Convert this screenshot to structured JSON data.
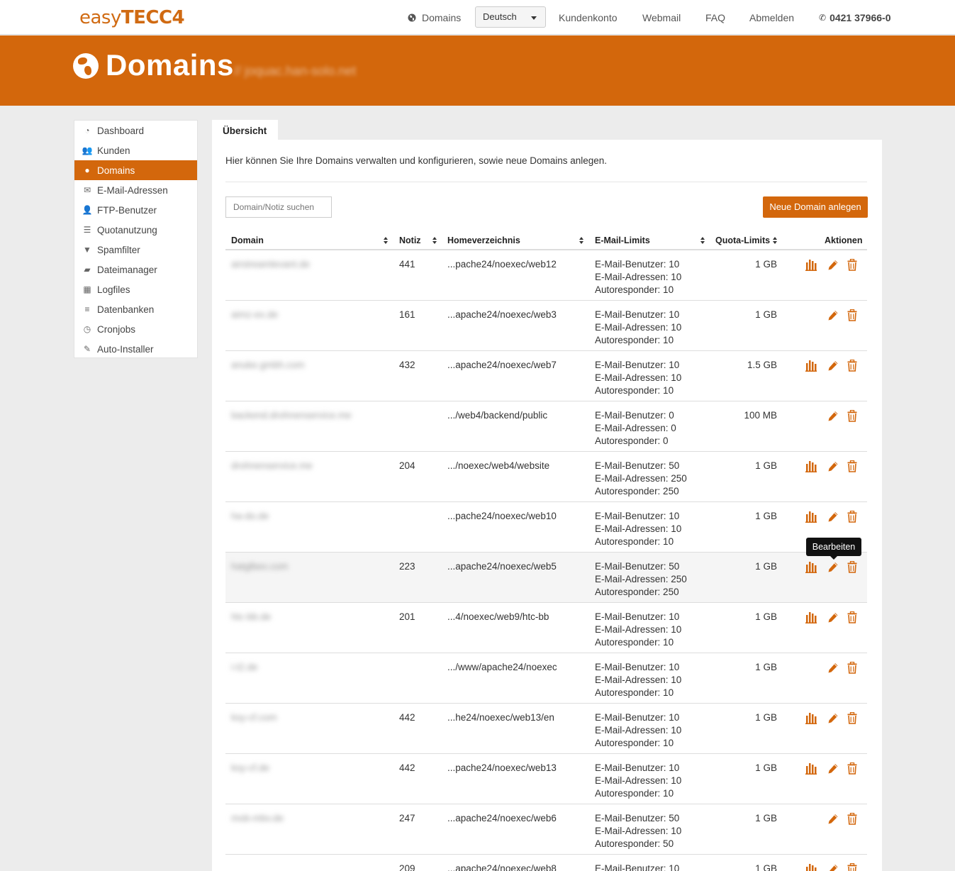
{
  "brand": {
    "part1": "easy",
    "part2": "TECC4"
  },
  "topnav": {
    "domains_label": "Domains",
    "language": "Deutsch",
    "customer_account": "Kundenkonto",
    "webmail": "Webmail",
    "faq": "FAQ",
    "logout": "Abmelden",
    "phone": "0421 37966-0"
  },
  "hero": {
    "title": "Domains",
    "subtitle": "// joquac.han-solo.net"
  },
  "sidebar": {
    "items": [
      {
        "label": "Dashboard",
        "icon": "dashboard-icon",
        "glyph": "◔"
      },
      {
        "label": "Kunden",
        "icon": "users-icon",
        "glyph": "👥"
      },
      {
        "label": "Domains",
        "icon": "globe-icon",
        "glyph": "●",
        "active": true
      },
      {
        "label": "E-Mail-Adressen",
        "icon": "envelope-icon",
        "glyph": "✉"
      },
      {
        "label": "FTP-Benutzer",
        "icon": "user-icon",
        "glyph": "👤"
      },
      {
        "label": "Quotanutzung",
        "icon": "tasks-icon",
        "glyph": "☰"
      },
      {
        "label": "Spamfilter",
        "icon": "filter-icon",
        "glyph": "▼"
      },
      {
        "label": "Dateimanager",
        "icon": "folder-open-icon",
        "glyph": "▰"
      },
      {
        "label": "Logfiles",
        "icon": "calendar-icon",
        "glyph": "▦"
      },
      {
        "label": "Datenbanken",
        "icon": "list-icon",
        "glyph": "≡"
      },
      {
        "label": "Cronjobs",
        "icon": "clock-icon",
        "glyph": "◷"
      },
      {
        "label": "Auto-Installer",
        "icon": "magic-icon",
        "glyph": "✎"
      }
    ]
  },
  "tab": "Übersicht",
  "intro": "Hier können Sie Ihre Domains verwalten und konfigurieren, sowie neue Domains anlegen.",
  "search_placeholder": "Domain/Notiz suchen",
  "new_domain_button": "Neue Domain anlegen",
  "columns": {
    "domain": "Domain",
    "notiz": "Notiz",
    "home": "Homeverzeichnis",
    "mail": "E-Mail-Limits",
    "quota": "Quota-Limits",
    "actions": "Aktionen"
  },
  "rows": [
    {
      "domain": "airstreamlevant.de",
      "notiz": "441",
      "home": "...pache24/noexec/web12",
      "mail": [
        "E-Mail-Benutzer: 10",
        "E-Mail-Adressen: 10",
        "Autoresponder: 10"
      ],
      "quota": "1 GB",
      "stats": true
    },
    {
      "domain": "aimz-ex.de",
      "notiz": "161",
      "home": "...apache24/noexec/web3",
      "mail": [
        "E-Mail-Benutzer: 10",
        "E-Mail-Adressen: 10",
        "Autoresponder: 10"
      ],
      "quota": "1 GB",
      "stats": false
    },
    {
      "domain": "anuke.gmbh.com",
      "notiz": "432",
      "home": "...apache24/noexec/web7",
      "mail": [
        "E-Mail-Benutzer: 10",
        "E-Mail-Adressen: 10",
        "Autoresponder: 10"
      ],
      "quota": "1.5 GB",
      "stats": true
    },
    {
      "domain": "backend.drohnenservice.me",
      "notiz": "",
      "home": ".../web4/backend/public",
      "mail": [
        "E-Mail-Benutzer: 0",
        "E-Mail-Adressen: 0",
        "Autoresponder: 0"
      ],
      "quota": "100 MB",
      "stats": false
    },
    {
      "domain": "drohnenservice.me",
      "notiz": "204",
      "home": ".../noexec/web4/website",
      "mail": [
        "E-Mail-Benutzer: 50",
        "E-Mail-Adressen: 250",
        "Autoresponder: 250"
      ],
      "quota": "1 GB",
      "stats": true
    },
    {
      "domain": "ha-do.de",
      "notiz": "",
      "home": "...pache24/noexec/web10",
      "mail": [
        "E-Mail-Benutzer: 10",
        "E-Mail-Adressen: 10",
        "Autoresponder: 10"
      ],
      "quota": "1 GB",
      "stats": true
    },
    {
      "domain": "hatglbex.com",
      "notiz": "223",
      "home": "...apache24/noexec/web5",
      "mail": [
        "E-Mail-Benutzer: 50",
        "E-Mail-Adressen: 250",
        "Autoresponder: 250"
      ],
      "quota": "1 GB",
      "stats": true,
      "hover": true
    },
    {
      "domain": "htc-bb.de",
      "notiz": "201",
      "home": "...4/noexec/web9/htc-bb",
      "mail": [
        "E-Mail-Benutzer: 10",
        "E-Mail-Adressen: 10",
        "Autoresponder: 10"
      ],
      "quota": "1 GB",
      "stats": true
    },
    {
      "domain": "i-t2.de",
      "notiz": "",
      "home": ".../www/apache24/noexec",
      "mail": [
        "E-Mail-Benutzer: 10",
        "E-Mail-Adressen: 10",
        "Autoresponder: 10"
      ],
      "quota": "1 GB",
      "stats": false
    },
    {
      "domain": "ksy-cf.com",
      "notiz": "442",
      "home": "...he24/noexec/web13/en",
      "mail": [
        "E-Mail-Benutzer: 10",
        "E-Mail-Adressen: 10",
        "Autoresponder: 10"
      ],
      "quota": "1 GB",
      "stats": true
    },
    {
      "domain": "ksy-cf.de",
      "notiz": "442",
      "home": "...pache24/noexec/web13",
      "mail": [
        "E-Mail-Benutzer: 10",
        "E-Mail-Adressen: 10",
        "Autoresponder: 10"
      ],
      "quota": "1 GB",
      "stats": true
    },
    {
      "domain": "mob-mbv.de",
      "notiz": "247",
      "home": "...apache24/noexec/web6",
      "mail": [
        "E-Mail-Benutzer: 50",
        "E-Mail-Adressen: 10",
        "Autoresponder: 50"
      ],
      "quota": "1 GB",
      "stats": false
    },
    {
      "domain": "",
      "notiz": "209",
      "home": "...apache24/noexec/web8",
      "mail": [
        "E-Mail-Benutzer: 10",
        "",
        ""
      ],
      "quota": "1 GB",
      "stats": true
    }
  ],
  "tooltip": "Bearbeiten",
  "colors": {
    "accent": "#d3670c",
    "accent_dark": "#c4600a"
  }
}
